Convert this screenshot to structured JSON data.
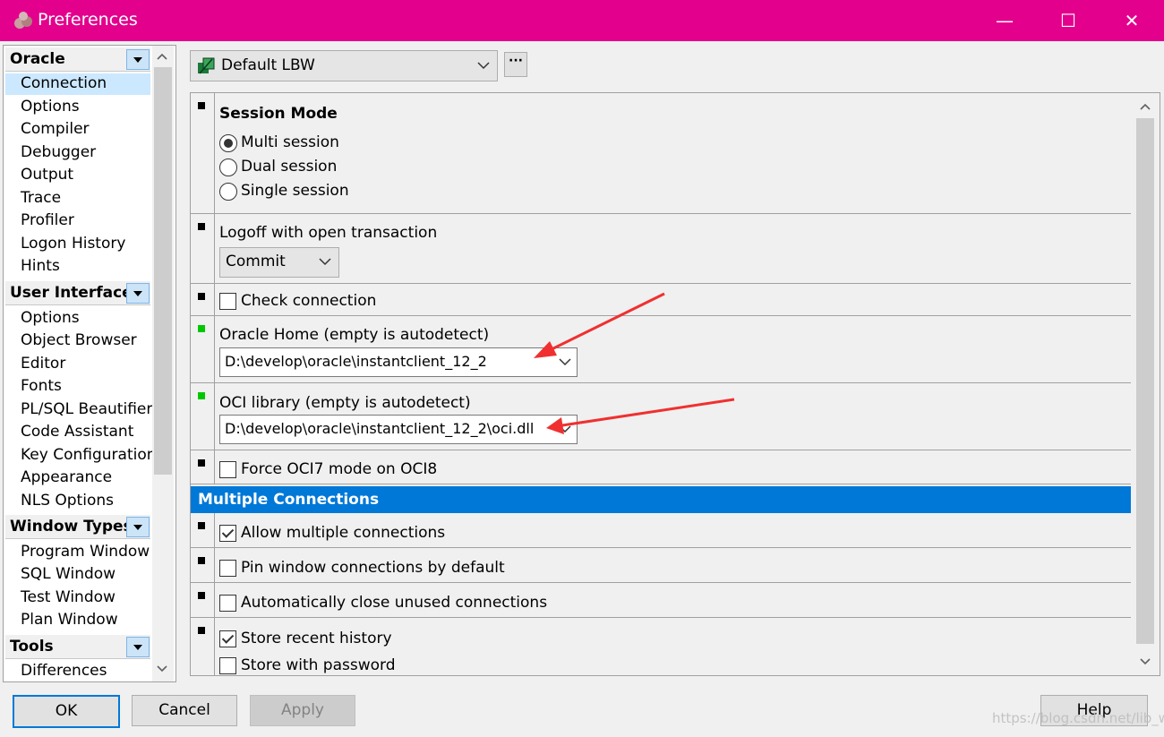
{
  "window": {
    "title": "Preferences",
    "minimize_glyph": "—",
    "maximize_glyph": "☐",
    "close_glyph": "✕",
    "accent_color": "#e3008c"
  },
  "nav": {
    "groups": [
      {
        "label": "Oracle",
        "items": [
          "Connection",
          "Options",
          "Compiler",
          "Debugger",
          "Output",
          "Trace",
          "Profiler",
          "Logon History",
          "Hints"
        ]
      },
      {
        "label": "User Interface",
        "items": [
          "Options",
          "Object Browser",
          "Editor",
          "Fonts",
          "PL/SQL Beautifier",
          "Code Assistant",
          "Key Configuration",
          "Appearance",
          "NLS Options"
        ]
      },
      {
        "label": "Window Types",
        "items": [
          "Program Window",
          "SQL Window",
          "Test Window",
          "Plan Window"
        ]
      },
      {
        "label": "Tools",
        "items": [
          "Differences"
        ]
      }
    ],
    "selected": "Connection"
  },
  "profile": {
    "value": "Default LBW",
    "more_label": "···"
  },
  "session_mode": {
    "heading": "Session Mode",
    "options": [
      "Multi session",
      "Dual session",
      "Single session"
    ],
    "selected": "Multi session"
  },
  "logoff": {
    "label": "Logoff with open transaction",
    "value": "Commit"
  },
  "check_connection": {
    "label": "Check connection",
    "checked": false
  },
  "oracle_home": {
    "label": "Oracle Home (empty is autodetect)",
    "value": "D:\\develop\\oracle\\instantclient_12_2"
  },
  "oci_library": {
    "label": "OCI library (empty is autodetect)",
    "value": "D:\\develop\\oracle\\instantclient_12_2\\oci.dll"
  },
  "force_oci7": {
    "label": "Force OCI7 mode on OCI8",
    "checked": false
  },
  "multiple_connections": {
    "heading": "Multiple Connections",
    "allow": {
      "label": "Allow multiple connections",
      "checked": true
    },
    "pin": {
      "label": "Pin window connections by default",
      "checked": false
    },
    "auto_close": {
      "label": "Automatically close unused connections",
      "checked": false
    },
    "store_history": {
      "label": "Store recent history",
      "checked": true
    },
    "store_password": {
      "label": "Store with password",
      "checked": false
    }
  },
  "buttons": {
    "ok": "OK",
    "cancel": "Cancel",
    "apply": "Apply",
    "help": "Help"
  },
  "watermark": "https://blog.csdn.net/lib_w",
  "colors": {
    "selection": "#0078d7",
    "modified_marker": "#00c800",
    "annotation_arrow": "#f03030"
  }
}
